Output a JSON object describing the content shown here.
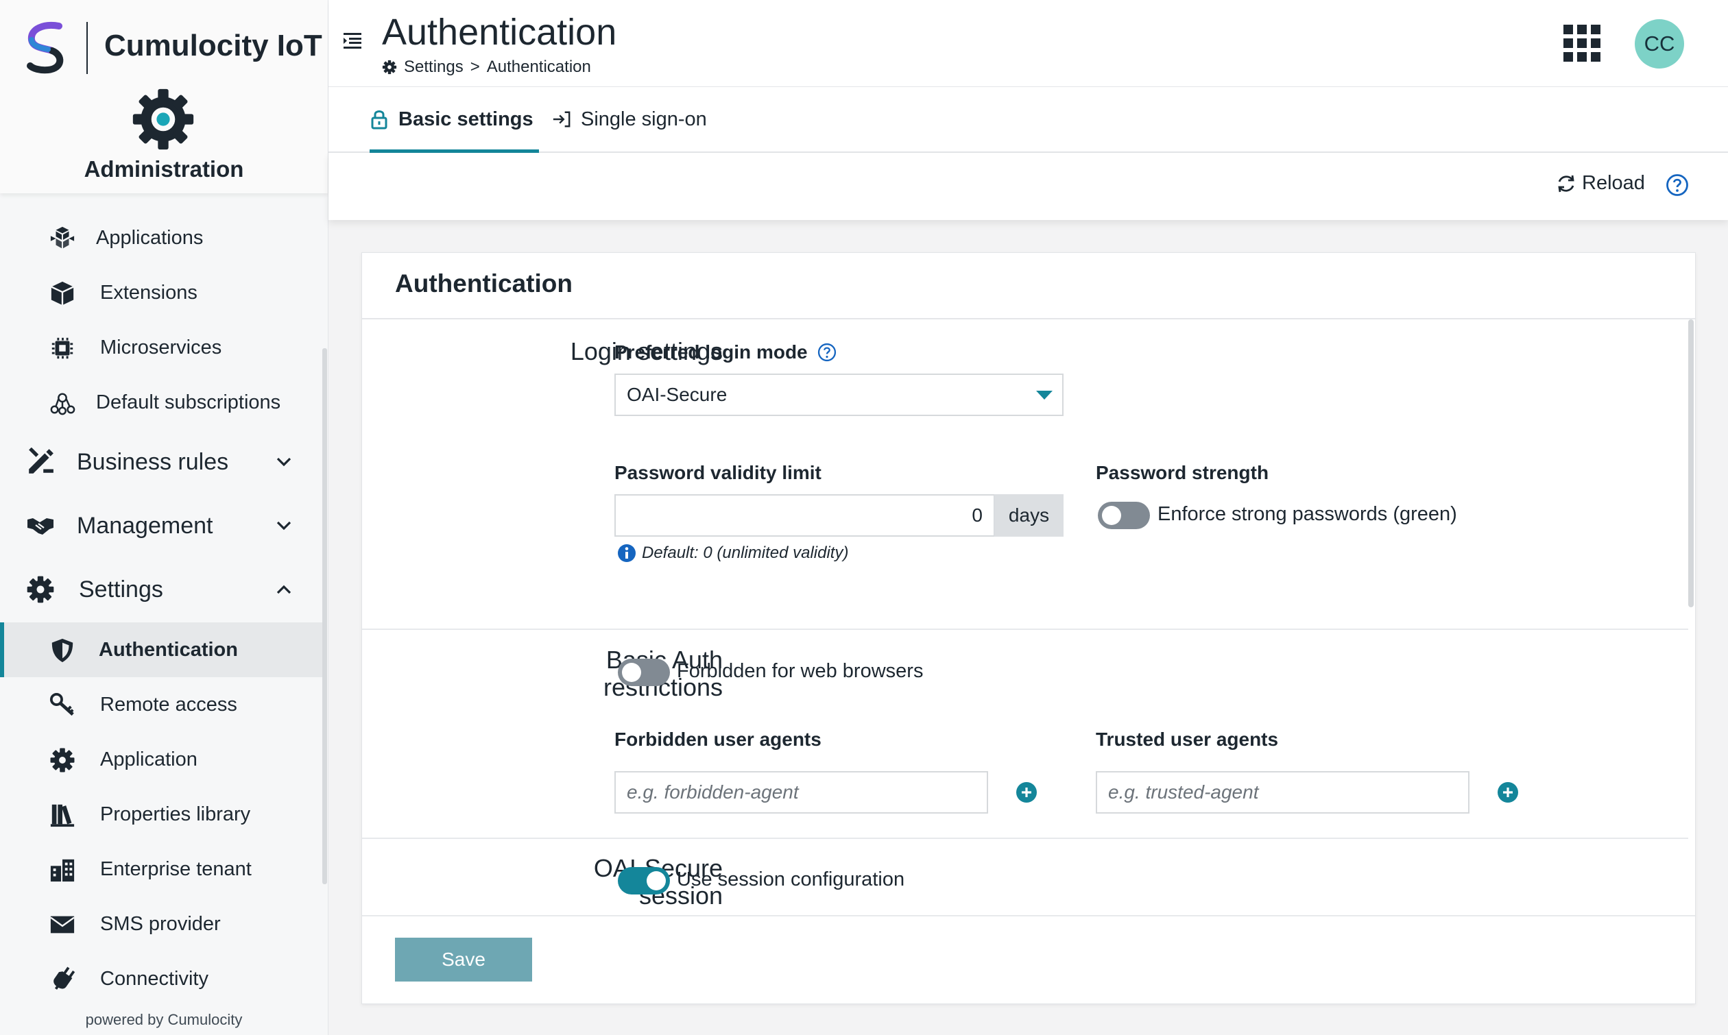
{
  "app": {
    "brand": "Cumulocity IoT",
    "section": "Administration",
    "powered_by": "powered by Cumulocity"
  },
  "sidebar": {
    "items": [
      {
        "label": "Applications"
      },
      {
        "label": "Extensions"
      },
      {
        "label": "Microservices"
      },
      {
        "label": "Default subscriptions"
      }
    ],
    "groups": [
      {
        "label": "Business rules",
        "expanded": false
      },
      {
        "label": "Management",
        "expanded": false
      },
      {
        "label": "Settings",
        "expanded": true
      }
    ],
    "settings_items": [
      {
        "label": "Authentication",
        "active": true
      },
      {
        "label": "Remote access"
      },
      {
        "label": "Application"
      },
      {
        "label": "Properties library"
      },
      {
        "label": "Enterprise tenant"
      },
      {
        "label": "SMS provider"
      },
      {
        "label": "Connectivity"
      }
    ]
  },
  "header": {
    "title": "Authentication",
    "breadcrumb": {
      "root": "Settings",
      "separator": ">",
      "current": "Authentication"
    },
    "avatar_initials": "CC"
  },
  "tabs": [
    {
      "label": "Basic settings",
      "active": true
    },
    {
      "label": "Single sign-on",
      "active": false
    }
  ],
  "actions": {
    "reload": "Reload"
  },
  "card": {
    "title": "Authentication",
    "login": {
      "section_title": "Login settings",
      "mode_label": "Preferred login mode",
      "mode_value": "OAI-Secure",
      "validity_label": "Password validity limit",
      "validity_value": "0",
      "validity_unit": "days",
      "validity_hint": "Default: 0 (unlimited validity)",
      "strength_label": "Password strength",
      "strength_toggle": "Enforce strong passwords (green)",
      "strength_on": false
    },
    "basic_auth": {
      "section_title_1": "Basic Auth",
      "section_title_2": "restrictions",
      "forbid_toggle": "Forbidden for web browsers",
      "forbid_on": false,
      "forbidden_label": "Forbidden user agents",
      "forbidden_placeholder": "e.g. forbidden-agent",
      "trusted_label": "Trusted user agents",
      "trusted_placeholder": "e.g. trusted-agent"
    },
    "session": {
      "section_title_1": "OAI-Secure",
      "section_title_2": "session",
      "toggle": "Use session configuration",
      "on": true
    },
    "save": "Save"
  },
  "colors": {
    "accent": "#14869a",
    "avatar": "#7dd2c7",
    "save_button": "#6ea7b3",
    "info": "#1565c0"
  }
}
